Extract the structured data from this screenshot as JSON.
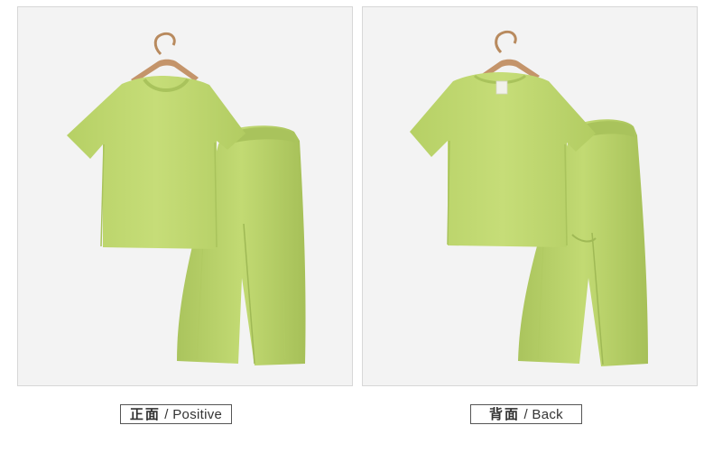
{
  "views": [
    {
      "id": "front",
      "label_cn": "正面",
      "label_sep": " / ",
      "label_en": "Positive"
    },
    {
      "id": "back",
      "label_cn": "背面",
      "label_sep": " / ",
      "label_en": "Back"
    }
  ],
  "colors": {
    "garment": "#bcd56c",
    "garment_shadow": "#a8c25a",
    "garment_light": "#c9df80",
    "hanger": "#c4946a",
    "background": "#f3f3f3"
  }
}
